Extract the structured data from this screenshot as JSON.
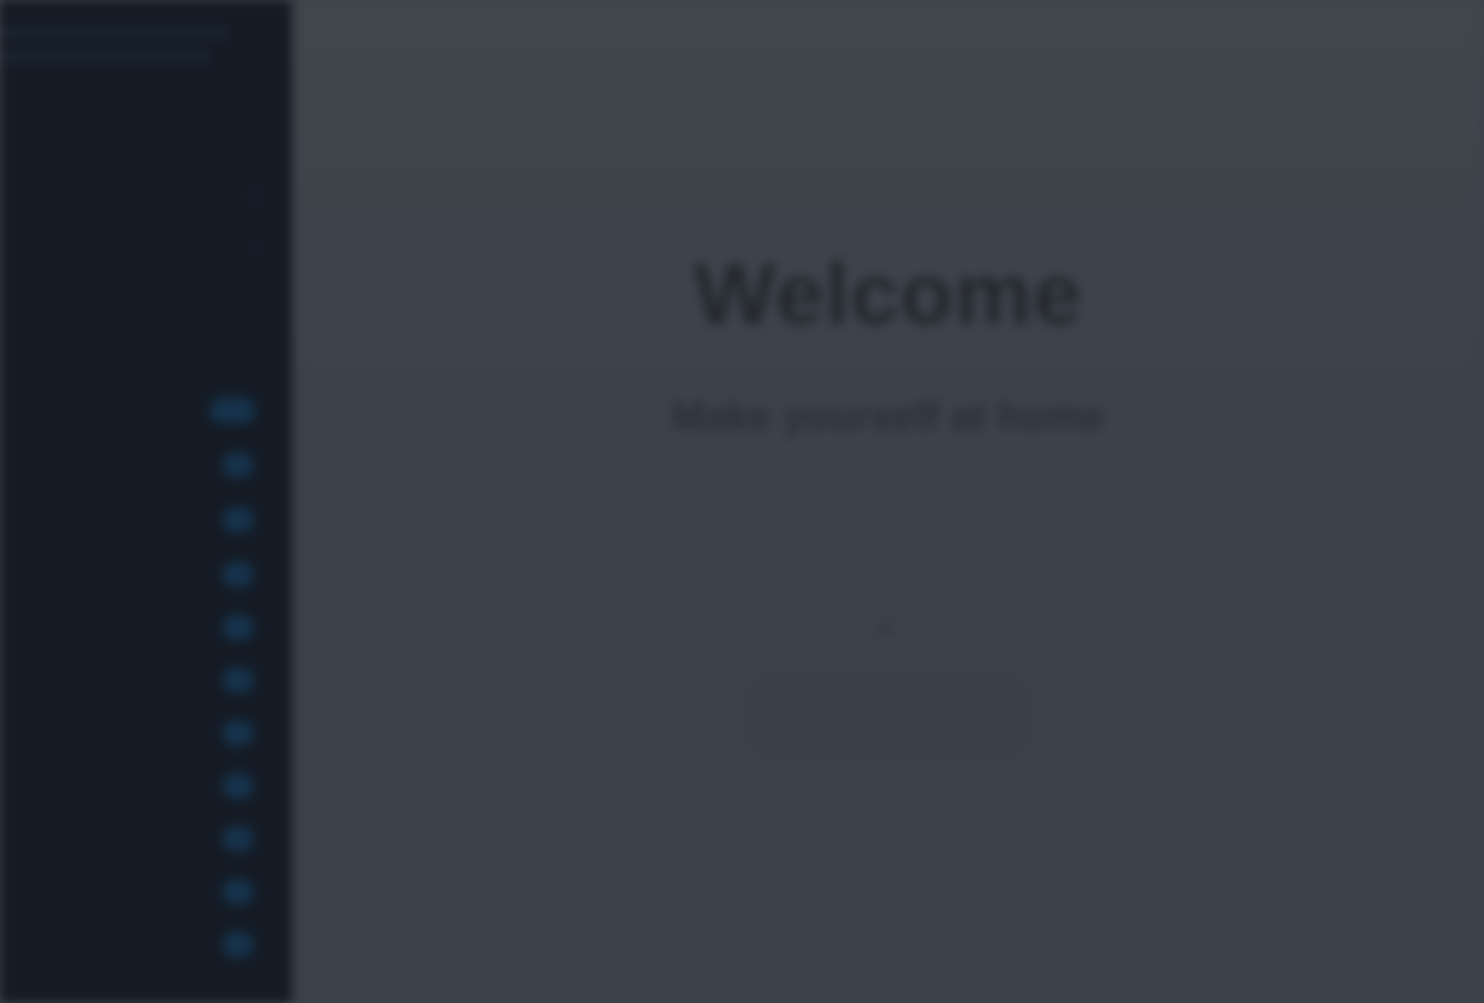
{
  "sidebar": {
    "section_labels": [
      "",
      ""
    ],
    "items_top": [
      {
        "label": "",
        "chevron": "chevron-down-icon"
      },
      {
        "label": "",
        "chevron": "chevron-down-icon"
      }
    ],
    "items": [
      {
        "label": "",
        "badge": ""
      },
      {
        "label": "",
        "badge": ""
      },
      {
        "label": "",
        "badge": ""
      },
      {
        "label": "",
        "badge": ""
      },
      {
        "label": "",
        "badge": ""
      },
      {
        "label": "",
        "badge": ""
      },
      {
        "label": "",
        "badge": ""
      },
      {
        "label": "",
        "badge": ""
      },
      {
        "label": "",
        "badge": ""
      },
      {
        "label": "",
        "badge": ""
      },
      {
        "label": "",
        "badge": ""
      }
    ]
  },
  "main": {
    "title": "Welcome",
    "subtitle": "Make yourself at home",
    "tagline": "",
    "cta_icon": "arrow-icon",
    "cta_label": ""
  },
  "colors": {
    "sidebar_bg": "#141b25",
    "main_bg": "#3d414a",
    "badge_bg": "#16334c"
  }
}
